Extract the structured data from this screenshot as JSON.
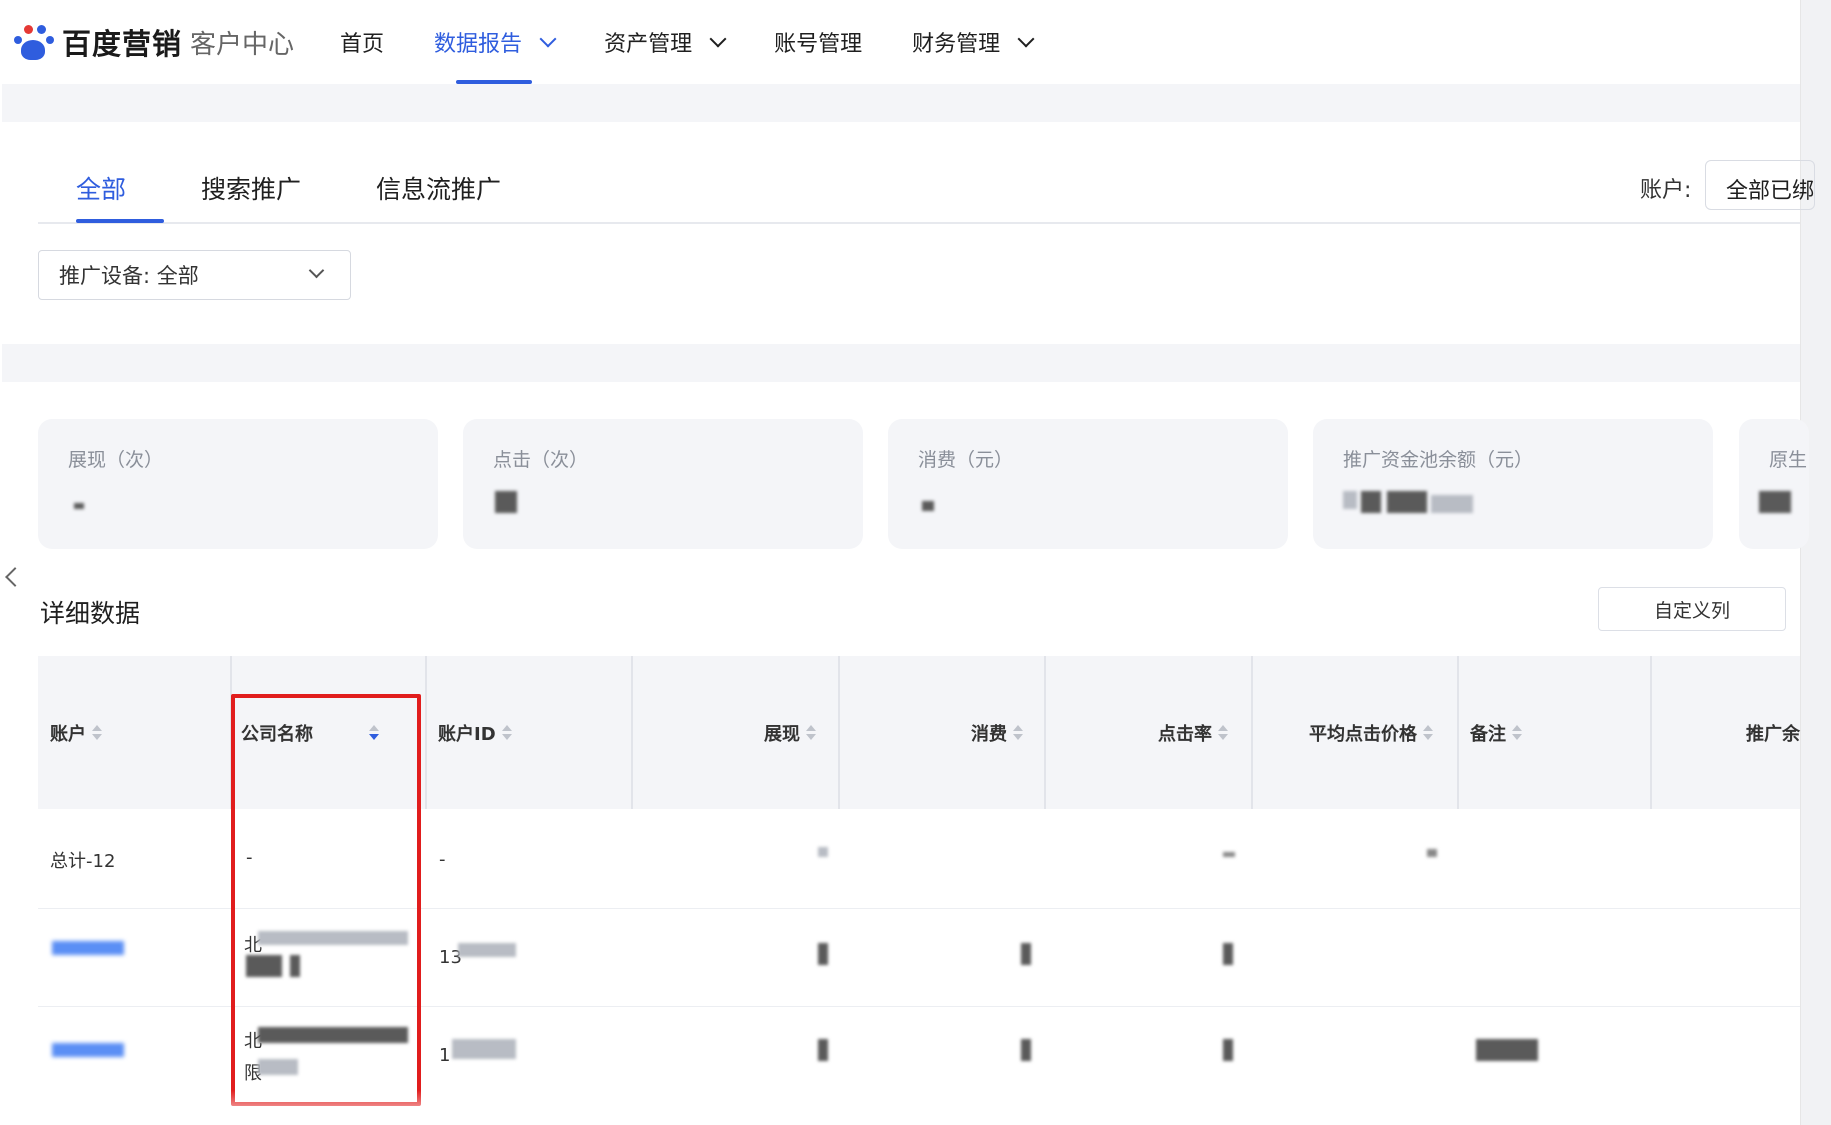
{
  "header": {
    "brand": "百度营销",
    "subtitle": "客户中心",
    "nav": [
      {
        "label": "首页",
        "dropdown": false,
        "active": false
      },
      {
        "label": "数据报告",
        "dropdown": true,
        "active": true
      },
      {
        "label": "资产管理",
        "dropdown": true,
        "active": false
      },
      {
        "label": "账号管理",
        "dropdown": false,
        "active": false
      },
      {
        "label": "财务管理",
        "dropdown": true,
        "active": false
      }
    ]
  },
  "tabs": [
    {
      "label": "全部",
      "active": true
    },
    {
      "label": "搜索推广",
      "active": false
    },
    {
      "label": "信息流推广",
      "active": false
    }
  ],
  "account_filter": {
    "label": "账户:",
    "value": "全部已绑"
  },
  "device_filter": {
    "value": "推广设备: 全部"
  },
  "stats": [
    {
      "title": "展现（次）"
    },
    {
      "title": "点击（次）"
    },
    {
      "title": "消费（元）"
    },
    {
      "title": "推广资金池余额（元）"
    },
    {
      "title": "原生"
    }
  ],
  "detail": {
    "title": "详细数据",
    "custom_columns_button": "自定义列"
  },
  "table": {
    "columns": [
      {
        "label": "账户",
        "sort": "none"
      },
      {
        "label": "公司名称",
        "sort": "desc"
      },
      {
        "label": "账户ID",
        "sort": "none"
      },
      {
        "label": "展现",
        "sort": "none"
      },
      {
        "label": "消费",
        "sort": "none"
      },
      {
        "label": "点击率",
        "sort": "none"
      },
      {
        "label": "平均点击价格",
        "sort": "none"
      },
      {
        "label": "备注",
        "sort": "none"
      },
      {
        "label": "推广余",
        "sort": "none"
      }
    ],
    "total_row": {
      "account": "总计-12",
      "company": "-",
      "account_id": "-"
    },
    "rows": [
      {
        "company_prefix": "北",
        "account_id_prefix": "13"
      },
      {
        "company_prefix": "北",
        "company_line2_prefix": "限",
        "account_id_prefix": "1"
      }
    ]
  },
  "colors": {
    "accent": "#2f5dde",
    "highlight": "#e11d1d",
    "panel": "#f4f5f8"
  }
}
